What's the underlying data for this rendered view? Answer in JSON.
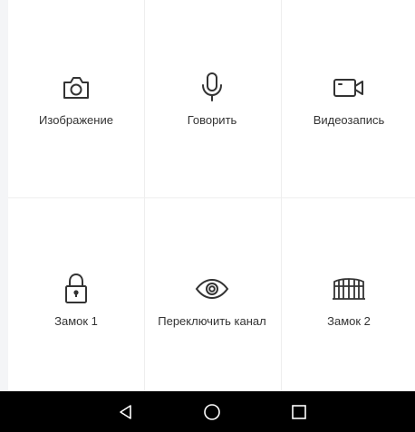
{
  "controls": {
    "row1": [
      {
        "label": "Изображение",
        "icon": "camera-icon"
      },
      {
        "label": "Говорить",
        "icon": "microphone-icon"
      },
      {
        "label": "Видеозапись",
        "icon": "video-camera-icon"
      }
    ],
    "row2": [
      {
        "label": "Замок 1",
        "icon": "padlock-icon"
      },
      {
        "label": "Переключить канал",
        "icon": "eye-icon"
      },
      {
        "label": "Замок 2",
        "icon": "gate-icon"
      }
    ]
  },
  "navbar": {
    "buttons": [
      "back-icon",
      "home-icon",
      "recents-icon"
    ]
  },
  "colors": {
    "icon": "#333333",
    "grid_line": "#eeeeee",
    "navbar": "#000000",
    "nav_icon": "#ffffff"
  }
}
